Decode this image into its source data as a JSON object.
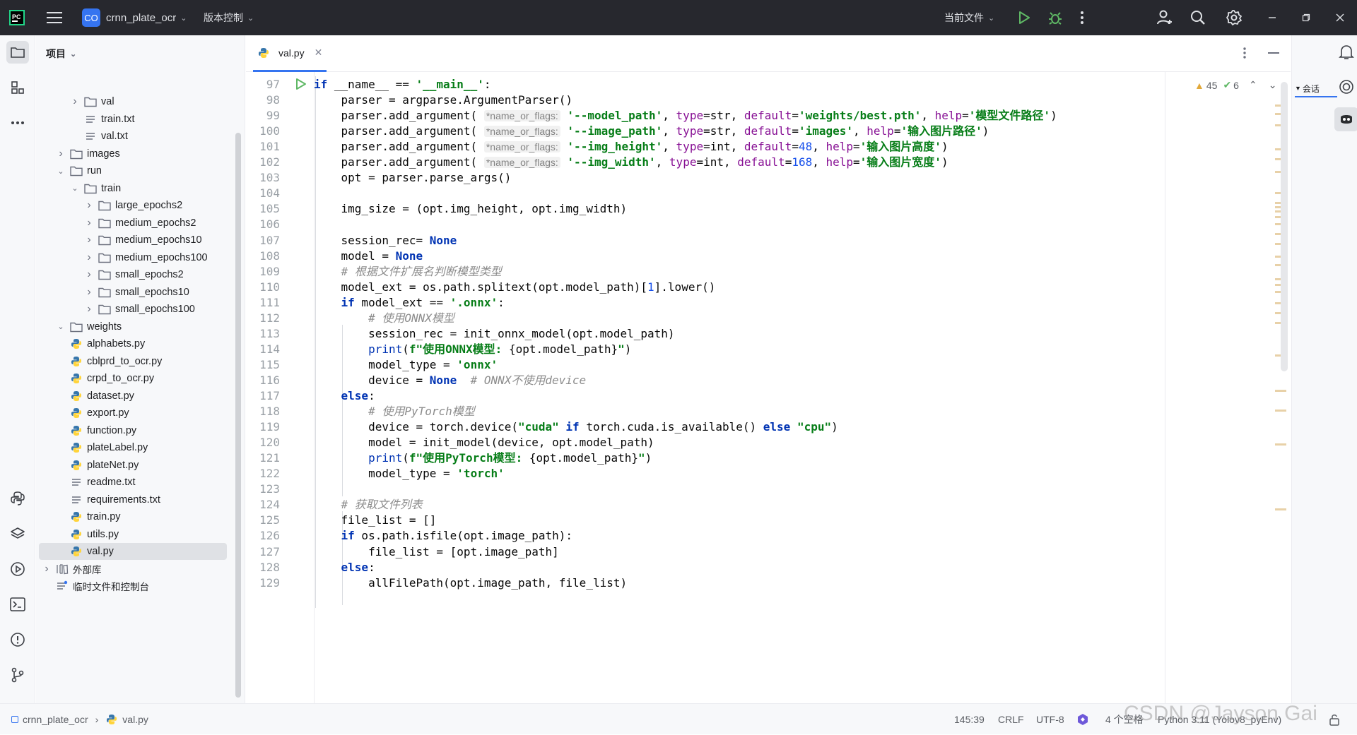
{
  "titlebar": {
    "project_badge": "CO",
    "project_name": "crnn_plate_ocr",
    "vcs_label": "版本控制",
    "run_config": "当前文件"
  },
  "project_panel": {
    "title": "项目",
    "tree": [
      {
        "label": "val",
        "type": "folder",
        "depth": 2,
        "state": "collapsed"
      },
      {
        "label": "train.txt",
        "type": "text",
        "depth": 2
      },
      {
        "label": "val.txt",
        "type": "text",
        "depth": 2
      },
      {
        "label": "images",
        "type": "folder",
        "depth": 1,
        "state": "collapsed"
      },
      {
        "label": "run",
        "type": "folder",
        "depth": 1,
        "state": "expanded"
      },
      {
        "label": "train",
        "type": "folder",
        "depth": 2,
        "state": "expanded"
      },
      {
        "label": "large_epochs2",
        "type": "folder",
        "depth": 3,
        "state": "collapsed"
      },
      {
        "label": "medium_epochs2",
        "type": "folder",
        "depth": 3,
        "state": "collapsed"
      },
      {
        "label": "medium_epochs10",
        "type": "folder",
        "depth": 3,
        "state": "collapsed"
      },
      {
        "label": "medium_epochs100",
        "type": "folder",
        "depth": 3,
        "state": "collapsed"
      },
      {
        "label": "small_epochs2",
        "type": "folder",
        "depth": 3,
        "state": "collapsed"
      },
      {
        "label": "small_epochs10",
        "type": "folder",
        "depth": 3,
        "state": "collapsed"
      },
      {
        "label": "small_epochs100",
        "type": "folder",
        "depth": 3,
        "state": "collapsed"
      },
      {
        "label": "weights",
        "type": "folder",
        "depth": 1,
        "state": "expanded"
      },
      {
        "label": "alphabets.py",
        "type": "python",
        "depth": 1
      },
      {
        "label": "cblprd_to_ocr.py",
        "type": "python",
        "depth": 1
      },
      {
        "label": "crpd_to_ocr.py",
        "type": "python",
        "depth": 1
      },
      {
        "label": "dataset.py",
        "type": "python",
        "depth": 1
      },
      {
        "label": "export.py",
        "type": "python",
        "depth": 1
      },
      {
        "label": "function.py",
        "type": "python",
        "depth": 1
      },
      {
        "label": "plateLabel.py",
        "type": "python",
        "depth": 1
      },
      {
        "label": "plateNet.py",
        "type": "python",
        "depth": 1
      },
      {
        "label": "readme.txt",
        "type": "text",
        "depth": 1
      },
      {
        "label": "requirements.txt",
        "type": "text",
        "depth": 1
      },
      {
        "label": "train.py",
        "type": "python",
        "depth": 1
      },
      {
        "label": "utils.py",
        "type": "python",
        "depth": 1
      },
      {
        "label": "val.py",
        "type": "python",
        "depth": 1,
        "selected": true
      },
      {
        "label": "外部库",
        "type": "library",
        "depth": 0,
        "state": "collapsed"
      },
      {
        "label": "临时文件和控制台",
        "type": "scratch",
        "depth": 0
      }
    ]
  },
  "editor": {
    "tab_label": "val.py",
    "warnings": "45",
    "checks": "6",
    "first_line_number": 97,
    "lines": [
      "<k>if</k> __name__ == <s>'__main__'</s>:",
      "    parser = argparse.ArgumentParser()",
      "    parser.add_argument( <h>*name_or_flags:</h> <s>'--model_path'</s>, <f>type</f>=str, <f>default</f>=<s>'weights/best.pth'</s>, <f>help</f>=<s>'模型文件路径'</s>)",
      "    parser.add_argument( <h>*name_or_flags:</h> <s>'--image_path'</s>, <f>type</f>=str, <f>default</f>=<s>'images'</s>, <f>help</f>=<s>'输入图片路径'</s>)",
      "    parser.add_argument( <h>*name_or_flags:</h> <s>'--img_height'</s>, <f>type</f>=int, <f>default</f>=<n>48</n>, <f>help</f>=<s>'输入图片高度'</s>)",
      "    parser.add_argument( <h>*name_or_flags:</h> <s>'--img_width'</s>, <f>type</f>=int, <f>default</f>=<n>168</n>, <f>help</f>=<s>'输入图片宽度'</s>)",
      "    opt = parser.parse_args()",
      "",
      "    img_size = (opt.img_height, opt.img_width)",
      "",
      "    session_rec= <k>None</k>",
      "    model = <k>None</k>",
      "    <c># 根据文件扩展名判断模型类型</c>",
      "    model_ext = os.path.splitext(opt.model_path)[<n>1</n>].lower()",
      "    <k>if</k> model_ext == <s>'.onnx'</s>:",
      "        <c># 使用ONNX模型</c>",
      "        session_rec = init_onnx_model(opt.model_path)",
      "        <p>print</p>(<s>f\"使用ONNX模型: </s>{opt.model_path}<s>\"</s>)",
      "        model_type = <s>'onnx'</s>",
      "        device = <k>None</k>  <c># ONNX不使用device</c>",
      "    <k>else</k>:",
      "        <c># 使用PyTorch模型</c>",
      "        device = torch.device(<s>\"cuda\"</s> <k>if</k> torch.cuda.is_available() <k>else</k> <s>\"cpu\"</s>)",
      "        model = init_model(device, opt.model_path)",
      "        <p>print</p>(<s>f\"使用PyTorch模型: </s>{opt.model_path}<s>\"</s>)",
      "        model_type = <s>'torch'</s>",
      "",
      "    <c># 获取文件列表</c>",
      "    file_list = []",
      "    <k>if</k> os.path.isfile(opt.image_path):",
      "        file_list = [opt.image_path]",
      "    <k>else</k>:",
      "        allFilePath(opt.image_path, file_list)"
    ]
  },
  "right_strip": {
    "chat_label": "会话"
  },
  "statusbar": {
    "breadcrumb_project": "crnn_plate_ocr",
    "breadcrumb_file": "val.py",
    "position": "145:39",
    "line_sep": "CRLF",
    "encoding": "UTF-8",
    "indent": "4 个空格",
    "interpreter": "Python 3.11 (Yolov8_pyEnv)"
  },
  "watermark": "CSDN @Jayson Gai",
  "colors": {
    "titlebar_bg": "#27282e",
    "accent": "#3574f0",
    "keyword": "#0033b3",
    "string": "#067d17",
    "comment": "#8c8c8c",
    "number": "#1750eb",
    "param": "#871094"
  }
}
